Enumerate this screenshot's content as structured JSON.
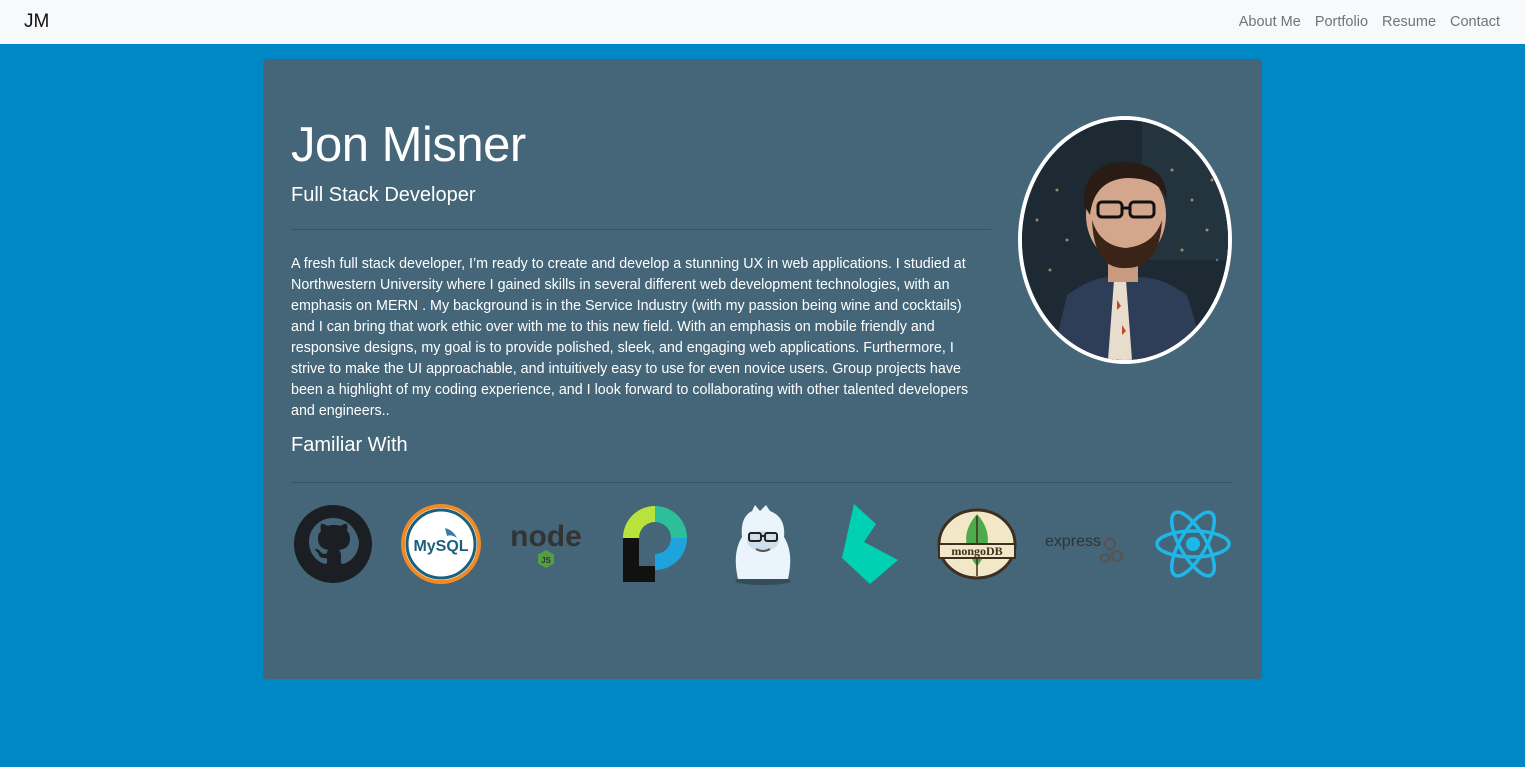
{
  "navbar": {
    "brand": "JM",
    "links": [
      "About Me",
      "Portfolio",
      "Resume",
      "Contact"
    ]
  },
  "profile": {
    "name": "Jon Misner",
    "title": "Full Stack Developer",
    "bio": "A fresh full stack developer, I’m ready to create and develop a stunning UX in web applications. I studied at Northwestern University where I gained skills in several different web development technologies, with an emphasis on MERN . My background is in the Service Industry (with my passion being wine and cocktails) and I can bring that work ethic over with me to this new field. With an emphasis on mobile friendly and responsive designs, my goal is to provide polished, sleek, and engaging web applications. Furthermore, I strive to make the UI approachable, and intuitively easy to use for even novice users. Group projects have been a highlight of my coding experience, and I look forward to collaborating with other talented developers and engineers..",
    "familiar_heading": "Familiar With"
  },
  "logo_text": {
    "mysql": "MySQL",
    "node": "node",
    "node_badge": "JS",
    "mongodb": "mongoDB",
    "express": "express"
  },
  "colors": {
    "page_bg": "#0088c4",
    "card_bg": "#446678",
    "navbar_bg": "#f8f9fa",
    "react_blue": "#1fb6e8",
    "bulma_teal": "#00d1b2"
  }
}
